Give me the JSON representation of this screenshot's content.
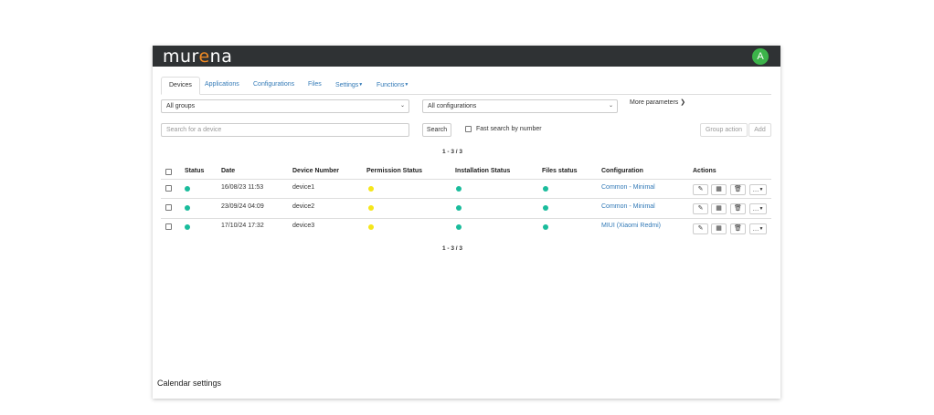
{
  "header": {
    "logo_prefix": "mur",
    "logo_e": "e",
    "logo_suffix": "na",
    "avatar_letter": "A"
  },
  "tabs": [
    "Devices",
    "Applications",
    "Configurations",
    "Files",
    "Settings",
    "Functions"
  ],
  "filters": {
    "group_select": "All groups",
    "configuration_select": "All configurations",
    "more_parameters": "More parameters"
  },
  "search": {
    "placeholder": "Search for a device",
    "button": "Search",
    "fast_search_label": "Fast search by number",
    "group_action": "Group action",
    "add": "Add"
  },
  "pager": {
    "top": "1 - 3 / 3",
    "bottom": "1 - 3 / 3"
  },
  "table": {
    "headers": [
      "Status",
      "Date",
      "Device Number",
      "Permission Status",
      "Installation Status",
      "Files status",
      "Configuration",
      "Actions"
    ],
    "rows": [
      {
        "date": "16/08/23 11:53",
        "device": "device1",
        "configuration": "Common - Minimal"
      },
      {
        "date": "23/09/24 04:09",
        "device": "device2",
        "configuration": "Common - Minimal"
      },
      {
        "date": "17/10/24 17:32",
        "device": "device3",
        "configuration": "MIUI (Xiaomi Redmi)"
      }
    ],
    "more_action": "…"
  },
  "colors": {
    "status_ok": "#1abc9c",
    "permission_warn": "#f5e61b",
    "link": "#337ab7",
    "avatar": "#3cb34a"
  },
  "footer": {
    "calendar_settings": "Calendar settings"
  }
}
